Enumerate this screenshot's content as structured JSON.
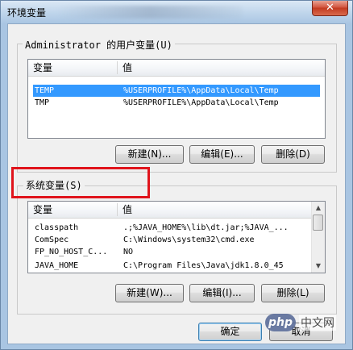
{
  "window": {
    "title": "环境变量",
    "close_glyph": "✕"
  },
  "user_vars": {
    "group_label": "Administrator 的用户变量(U)",
    "columns": [
      "变量",
      "值"
    ],
    "rows": [
      {
        "name": "TEMP",
        "value": "%USERPROFILE%\\AppData\\Local\\Temp",
        "selected": true
      },
      {
        "name": "TMP",
        "value": "%USERPROFILE%\\AppData\\Local\\Temp",
        "selected": false
      }
    ],
    "buttons": {
      "new": "新建(N)...",
      "edit": "编辑(E)...",
      "delete": "删除(D)"
    }
  },
  "system_vars": {
    "group_label": "系统变量(S)",
    "columns": [
      "变量",
      "值"
    ],
    "rows": [
      {
        "name": "classpath",
        "value": ".;%JAVA_HOME%\\lib\\dt.jar;%JAVA_..."
      },
      {
        "name": "ComSpec",
        "value": "C:\\Windows\\system32\\cmd.exe"
      },
      {
        "name": "FP_NO_HOST_C...",
        "value": "NO"
      },
      {
        "name": "JAVA_HOME",
        "value": "C:\\Program Files\\Java\\jdk1.8.0_45"
      }
    ],
    "buttons": {
      "new": "新建(W)...",
      "edit": "编辑(I)...",
      "delete": "删除(L)"
    }
  },
  "footer": {
    "ok": "确定",
    "cancel": "取消"
  },
  "watermark": {
    "logo": "php",
    "text": "中文网"
  },
  "colors": {
    "selection": "#3399ff",
    "highlight_box": "#e0141c"
  }
}
